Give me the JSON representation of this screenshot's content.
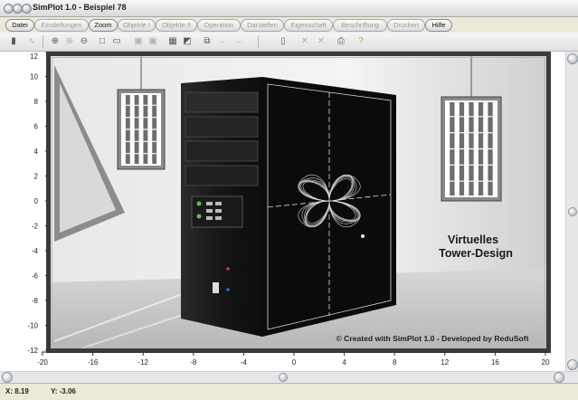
{
  "window": {
    "title": "SimPlot 1.0 - Beispiel 78"
  },
  "menu": [
    {
      "label": "Datei",
      "enabled": true
    },
    {
      "label": "Einstellungen",
      "enabled": false
    },
    {
      "label": "Zoom",
      "enabled": true
    },
    {
      "label": "Objekte I",
      "enabled": false
    },
    {
      "label": "Objekte II",
      "enabled": false
    },
    {
      "label": "Operation",
      "enabled": false
    },
    {
      "label": "Darstellen",
      "enabled": false
    },
    {
      "label": "Eigenschaft",
      "enabled": false
    },
    {
      "label": "Beschriftung",
      "enabled": false
    },
    {
      "label": "Drucken",
      "enabled": false
    },
    {
      "label": "Hilfe",
      "enabled": true
    }
  ],
  "toolbar": {
    "icons": [
      "phone-icon",
      "curve-icon",
      "zoom-in-icon",
      "zoom-region-icon",
      "zoom-out-icon",
      "square-icon",
      "window-icon",
      "frame-icon",
      "frame-2-icon",
      "grid-icon",
      "color-picker-icon",
      "copy-icon",
      "arrow-right-icon",
      "arrow-left-icon",
      "page-icon",
      "cross-icon",
      "cross-2-icon",
      "printer-icon",
      "help-bulb-icon"
    ]
  },
  "plot": {
    "x_ticks": [
      "-20",
      "-16",
      "-12",
      "-8",
      "-4",
      "0",
      "4",
      "8",
      "12",
      "16",
      "20"
    ],
    "y_ticks": [
      "12",
      "10",
      "8",
      "6",
      "4",
      "2",
      "0",
      "-2",
      "-4",
      "-6",
      "-8",
      "-10",
      "-12"
    ],
    "xlim": [
      -20,
      20
    ],
    "ylim": [
      -12,
      12
    ],
    "caption_line1": "Virtuelles",
    "caption_line2": "Tower-Design",
    "credit": "© Created with SimPlot 1.0 - Developed by ReduSoft",
    "colors": {
      "background": "#ececec",
      "tower": "#121212",
      "frame": "#3b3b3b"
    }
  },
  "status": {
    "x": "X: 8.19",
    "y": "Y: -3.06"
  }
}
